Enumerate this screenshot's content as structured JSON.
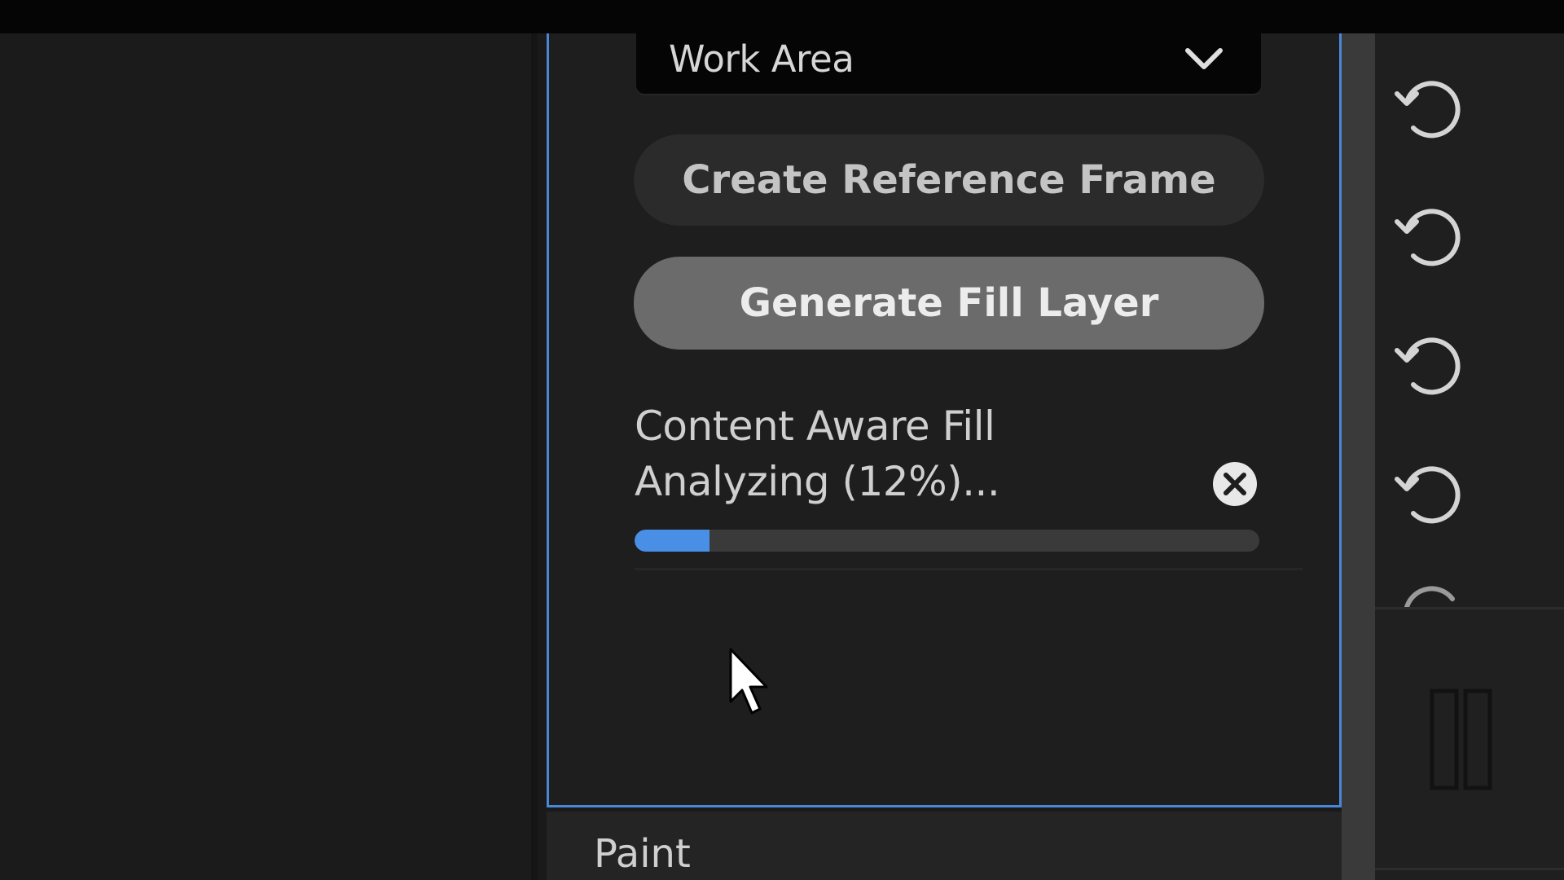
{
  "panel": {
    "dropdown_value": "Work Area",
    "buttons": {
      "create_reference": "Create Reference Frame",
      "generate_fill": "Generate Fill Layer"
    },
    "task": {
      "title": "Content Aware Fill",
      "status": "Analyzing (12%)...",
      "progress_fraction": 0.12
    }
  },
  "next_panel": {
    "label": "Paint"
  },
  "side_icons": [
    "reset-icon",
    "reset-icon",
    "reset-icon",
    "reset-icon",
    "reset-icon"
  ],
  "colors": {
    "accent": "#4a87d6",
    "progress": "#4a8fe6"
  }
}
